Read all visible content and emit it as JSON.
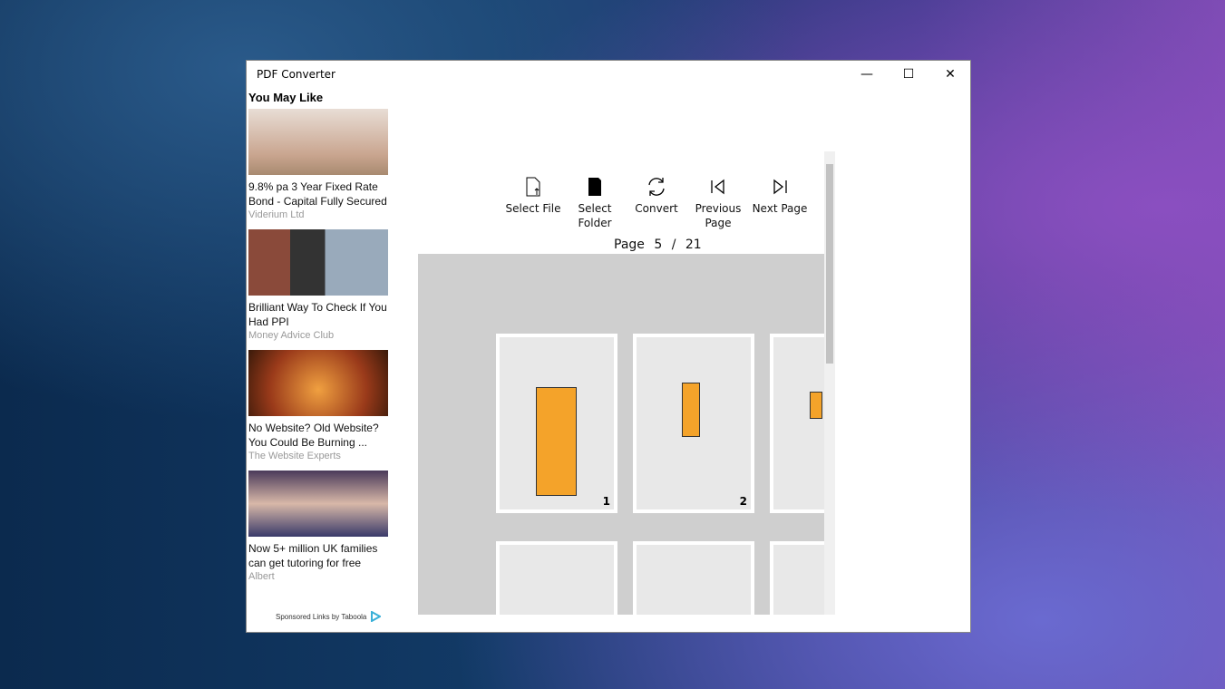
{
  "window": {
    "title": "PDF Converter",
    "minimize": "—",
    "maximize": "☐",
    "close": "✕"
  },
  "sidebar": {
    "heading": "You May Like",
    "ads": [
      {
        "title": "9.8% pa 3 Year Fixed Rate Bond - Capital Fully Secured",
        "source": "Viderium Ltd",
        "color": "#c9a58f"
      },
      {
        "title": "Brilliant Way To Check If You Had PPI",
        "source": "Money Advice Club",
        "color": "#8a4a3a"
      },
      {
        "title": "No Website? Old Website? You Could Be Burning ...",
        "source": "The Website Experts",
        "color": "#9a3a1a"
      },
      {
        "title": "Now 5+ million UK families can get tutoring for free",
        "source": "Albert",
        "color": "#5a4a6a"
      }
    ],
    "sponsored": "Sponsored Links by Taboola"
  },
  "toolbar": {
    "select_file": "Select File",
    "select_folder": "Select Folder",
    "convert": "Convert",
    "previous_page": "Previous Page",
    "next_page": "Next Page"
  },
  "pager": {
    "label": "Page",
    "current": 5,
    "total": 21,
    "text": "5 / 21"
  },
  "document": {
    "panels": [
      "1",
      "2"
    ]
  }
}
